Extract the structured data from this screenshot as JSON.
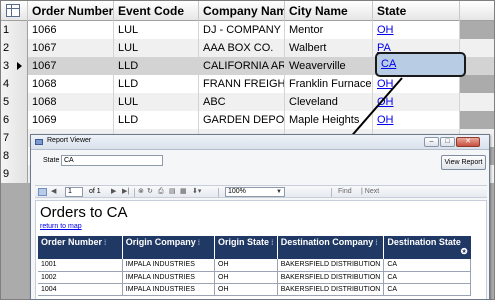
{
  "grid": {
    "columns": [
      "Order Number",
      "Event Code",
      "Company Name",
      "City Name",
      "State"
    ],
    "rows": [
      {
        "num": "1",
        "order": "1066",
        "event": "LUL",
        "company": "DJ - COMPANY",
        "city": "Mentor",
        "state": "OH"
      },
      {
        "num": "2",
        "order": "1067",
        "event": "LUL",
        "company": "AAA BOX CO.",
        "city": "Walbert",
        "state": "PA"
      },
      {
        "num": "3",
        "order": "1067",
        "event": "LLD",
        "company": "CALIFORNIA AR",
        "city": "Weaverville",
        "state": "CA"
      },
      {
        "num": "4",
        "order": "1068",
        "event": "LLD",
        "company": "FRANN FREIGHT",
        "city": "Franklin Furnace",
        "state": "OH"
      },
      {
        "num": "5",
        "order": "1068",
        "event": "LUL",
        "company": "ABC",
        "city": "Cleveland",
        "state": "OH"
      },
      {
        "num": "6",
        "order": "1069",
        "event": "LLD",
        "company": "GARDEN DEPOT",
        "city": "Maple Heights",
        "state": "OH"
      },
      {
        "num": "7",
        "order": "",
        "event": "",
        "company": "",
        "city": "",
        "state": ""
      },
      {
        "num": "8",
        "order": "",
        "event": "",
        "company": "",
        "city": "",
        "state": ""
      },
      {
        "num": "9",
        "order": "",
        "event": "",
        "company": "",
        "city": "",
        "state": ""
      }
    ],
    "selected_row": 3,
    "highlight_value": "CA"
  },
  "viewer": {
    "title": "Report Viewer",
    "param_label": "State",
    "param_value": "CA",
    "view_button": "View Report",
    "toolbar": {
      "page": "1",
      "of_text": "of 1",
      "zoom": "100%",
      "find": "Find",
      "next": "Next"
    },
    "report": {
      "heading": "Orders to CA",
      "back_link": "return to map",
      "columns": [
        "Order Number",
        "Origin Company",
        "Origin State",
        "Destination Company",
        "Destination State"
      ],
      "rows": [
        [
          "1001",
          "IMPALA INDUSTRIES",
          "OH",
          "BAKERSFIELD DISTRIBUTION",
          "CA"
        ],
        [
          "1002",
          "IMPALA INDUSTRIES",
          "OH",
          "BAKERSFIELD DISTRIBUTION",
          "CA"
        ],
        [
          "1004",
          "IMPALA INDUSTRIES",
          "OH",
          "BAKERSFIELD DISTRIBUTION",
          "CA"
        ]
      ]
    }
  },
  "colors": {
    "report_header": "#1f3864",
    "highlight": "#b8cce4",
    "link": "#0000ee"
  }
}
